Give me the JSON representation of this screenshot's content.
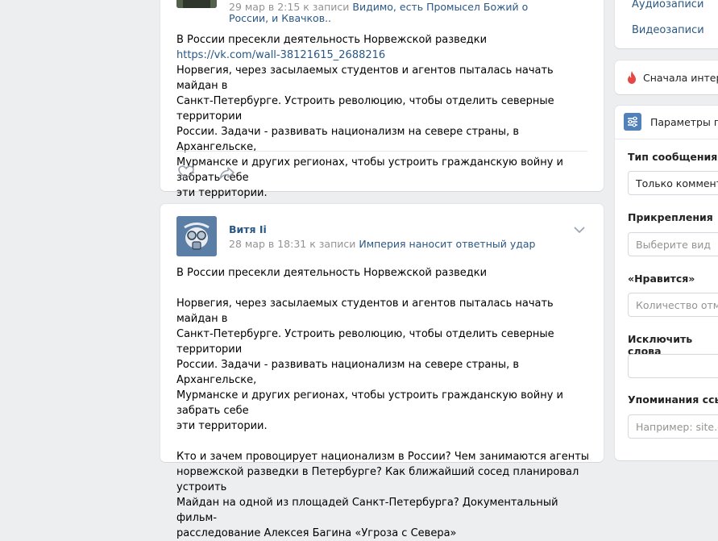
{
  "posts": [
    {
      "date": "29 мар в 2:15",
      "to_post_prefix": "к записи",
      "to_post_title": "Видимо, есть Промысел Божий о России, и Квачков..",
      "lines": [
        "В России пресекли деятельность Норвежской разведки",
        "https://vk.com/wall-38121615_2688216",
        "Норвегия, через засылаемых студентов и агентов пыталась начать майдан в",
        "Санкт-Петербурге. Устроить революцию, чтобы отделить северные территории",
        "России. Задачи - развивать национализм на севере страны, в Архангельске,",
        "Мурманске и других регионах, чтобы устроить гражданскую войну и забрать себе",
        "эти территории."
      ]
    },
    {
      "author": "Витя Ii",
      "date": "28 мар в 18:31",
      "to_post_prefix": "к записи",
      "to_post_title": "Империя наносит ответный удар",
      "paragraph1": "В России пресекли деятельность Норвежской разведки",
      "paragraph2_lines": [
        "Норвегия, через засылаемых студентов и агентов пыталась начать майдан в",
        "Санкт-Петербурге. Устроить революцию, чтобы отделить северные территории",
        "России. Задачи - развивать национализм на севере страны, в Архангельске,",
        "Мурманске и других регионах, чтобы устроить гражданскую войну и забрать себе",
        "эти территории."
      ],
      "paragraph3_lines": [
        "Кто и зачем провоцирует национализм в России? Чем занимаются агенты",
        "норвежской разведки в Петербурге? Как ближайший сосед планировал устроить",
        "Майдан на одной из площадей Санкт-Петербурга? Документальный фильм-",
        "расследование Алексея Багина «Угроза с Севера»"
      ]
    }
  ],
  "sidebar": {
    "menu_audio": "Аудиозаписи",
    "menu_video": "Видеозаписи",
    "sort_label": "Сначала интере",
    "filters_title": "Параметры по",
    "message_type_label": "Тип сообщения",
    "message_type_value": "Только коммента",
    "attachments_label": "Прикрепления",
    "attachments_placeholder": "Выберите вид",
    "likes_label": "«Нравится»",
    "likes_placeholder": "Количество отме",
    "exclude_label": "Исключить слова",
    "exclude_value": "",
    "mentions_label": "Упоминания ссылк",
    "mentions_placeholder": "Например: site.co"
  },
  "colors": {
    "link": "#2a5885",
    "muted": "#939393",
    "fire": "#e64646",
    "accent": "#5181b8"
  }
}
